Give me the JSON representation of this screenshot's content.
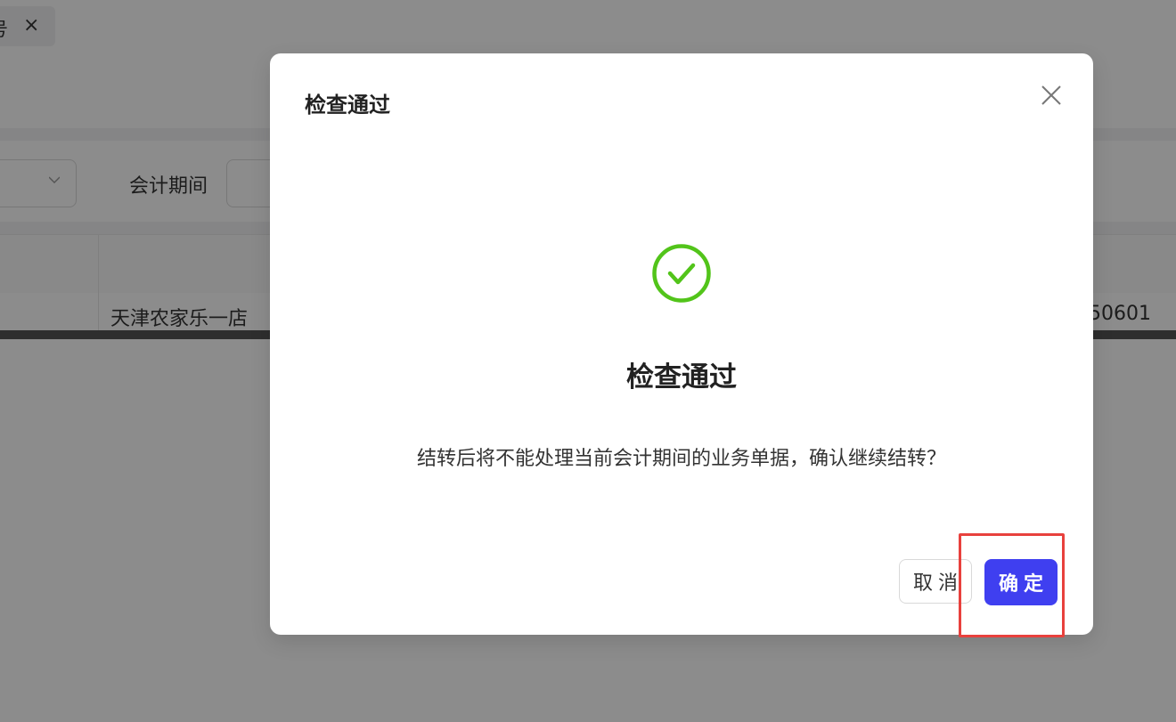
{
  "background": {
    "tab": {
      "label": "号",
      "close_glyph": "×"
    },
    "filter": {
      "period_label": "会计期间"
    },
    "table": {
      "rows": [
        {
          "store": "天津农家乐一店",
          "code": "50601"
        }
      ]
    }
  },
  "dialog": {
    "title": "检查通过",
    "result_title": "检查通过",
    "result_desc": "结转后将不能处理当前会计期间的业务单据，确认继续结转？",
    "cancel_label": "取消",
    "ok_label": "确定",
    "success_icon": "check-circle-icon",
    "close_icon": "close-icon"
  },
  "colors": {
    "primary": "#3f3ff0",
    "success": "#52c41a",
    "highlight": "#e8413d",
    "mask": "rgba(0,0,0,0.45)"
  }
}
